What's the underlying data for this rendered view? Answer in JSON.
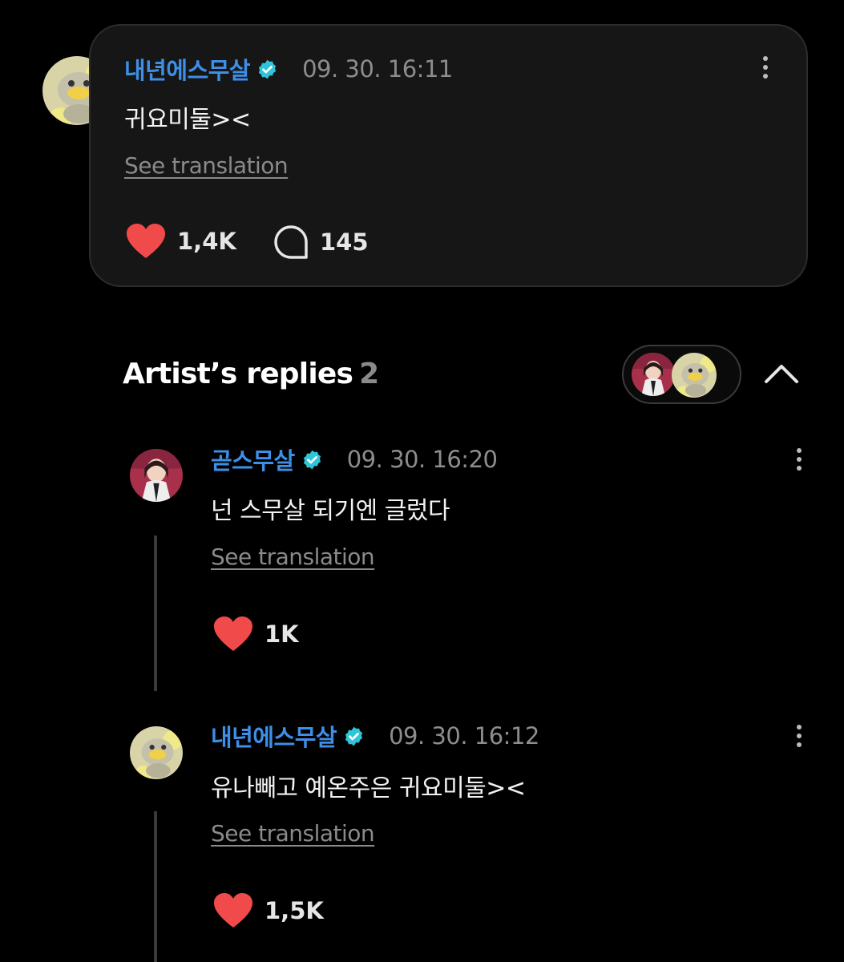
{
  "post": {
    "author": "내년에스무살",
    "timestamp": "09. 30. 16:11",
    "text": "귀요미둘><",
    "see_translation": "See translation",
    "likes": "1,4K",
    "comments": "145",
    "avatar_icon": "duck-avatar-icon"
  },
  "replies_section": {
    "title": "Artist’s replies",
    "count": "2"
  },
  "replies": [
    {
      "author": "곧스무살",
      "timestamp": "09. 30. 16:20",
      "text": "넌 스무살 되기엔 글렀다",
      "see_translation": "See translation",
      "likes": "1K",
      "avatar_icon": "girl-avatar-icon"
    },
    {
      "author": "내년에스무살",
      "timestamp": "09. 30. 16:12",
      "text": "유나빼고 예온주은 귀요미둘><",
      "see_translation": "See translation",
      "likes": "1,5K",
      "avatar_icon": "duck-avatar-icon"
    }
  ],
  "colors": {
    "background": "#000000",
    "card": "#161616",
    "author_blue": "#3d8fe8",
    "verified_teal": "#2ec5d8",
    "heart_red": "#f04a4a",
    "muted_text": "#8a8a8a"
  }
}
